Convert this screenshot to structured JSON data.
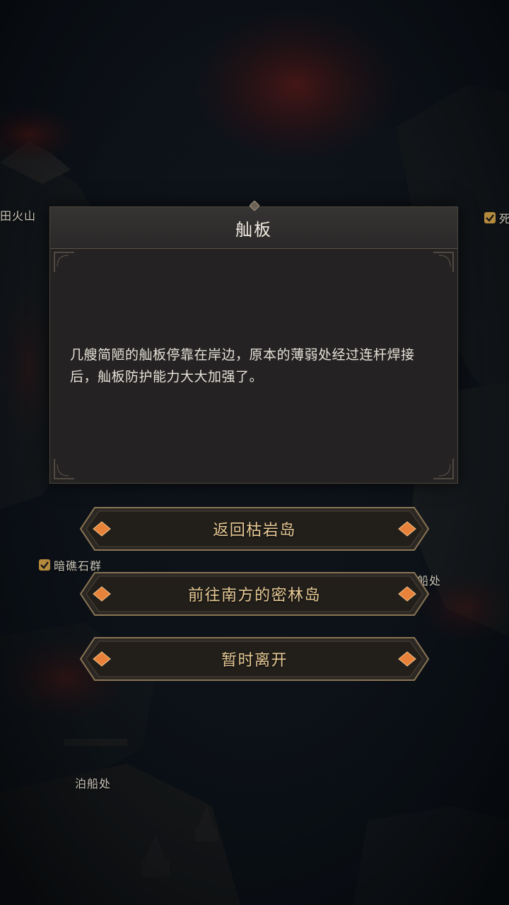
{
  "dialog": {
    "title": "舢板",
    "body": "几艘简陋的舢板停靠在岸边，原本的薄弱处经过连杆焊接后，舢板防护能力大大加强了。"
  },
  "choices": [
    {
      "label": "返回枯岩岛"
    },
    {
      "label": "前往南方的密林岛"
    },
    {
      "label": "暂时离开"
    }
  ],
  "map_labels": {
    "volcano": "田火山",
    "reef": "暗礁石群",
    "dock_right": "船处",
    "dock": "泊船处",
    "right_edge": "死"
  },
  "colors": {
    "dialog_bg": "#242222",
    "button_text": "#e7c995",
    "gem": "#e8823a",
    "lava": "#a0221a"
  }
}
